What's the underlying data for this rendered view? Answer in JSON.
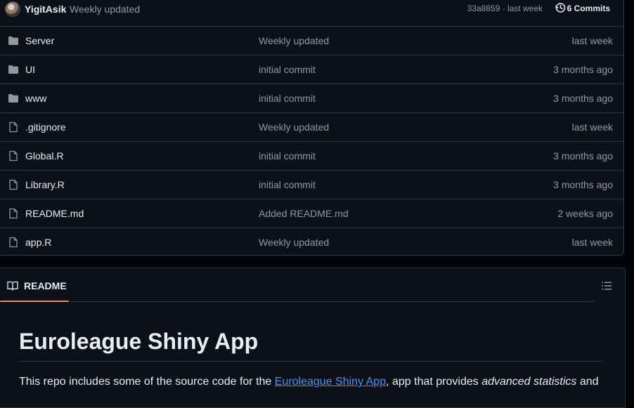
{
  "latest_commit": {
    "author": "YigitAsik",
    "message": "Weekly updated",
    "sha_and_time": "33a8859 · last week",
    "commits_label": "6 Commits"
  },
  "files": [
    {
      "type": "folder",
      "name": "Server",
      "message": "Weekly updated",
      "age": "last week"
    },
    {
      "type": "folder",
      "name": "UI",
      "message": "initial commit",
      "age": "3 months ago"
    },
    {
      "type": "folder",
      "name": "www",
      "message": "initial commit",
      "age": "3 months ago"
    },
    {
      "type": "file",
      "name": ".gitignore",
      "message": "Weekly updated",
      "age": "last week"
    },
    {
      "type": "file",
      "name": "Global.R",
      "message": "initial commit",
      "age": "3 months ago"
    },
    {
      "type": "file",
      "name": "Library.R",
      "message": "initial commit",
      "age": "3 months ago"
    },
    {
      "type": "file",
      "name": "README.md",
      "message": "Added README.md",
      "age": "2 weeks ago"
    },
    {
      "type": "file",
      "name": "app.R",
      "message": "Weekly updated",
      "age": "last week"
    }
  ],
  "readme": {
    "tab_label": "README",
    "title": "Euroleague Shiny App",
    "para_prefix": "This repo includes some of the source code for the ",
    "para_link": "Euroleague Shiny App",
    "para_mid": ", app that provides ",
    "para_em": "advanced statistics",
    "para_suffix": " and"
  },
  "colors": {
    "background": "#010409",
    "panel": "#0d1117",
    "border": "#30363d",
    "muted_text": "#9198a1",
    "link": "#4493f8",
    "tab_accent": "#f78166"
  }
}
